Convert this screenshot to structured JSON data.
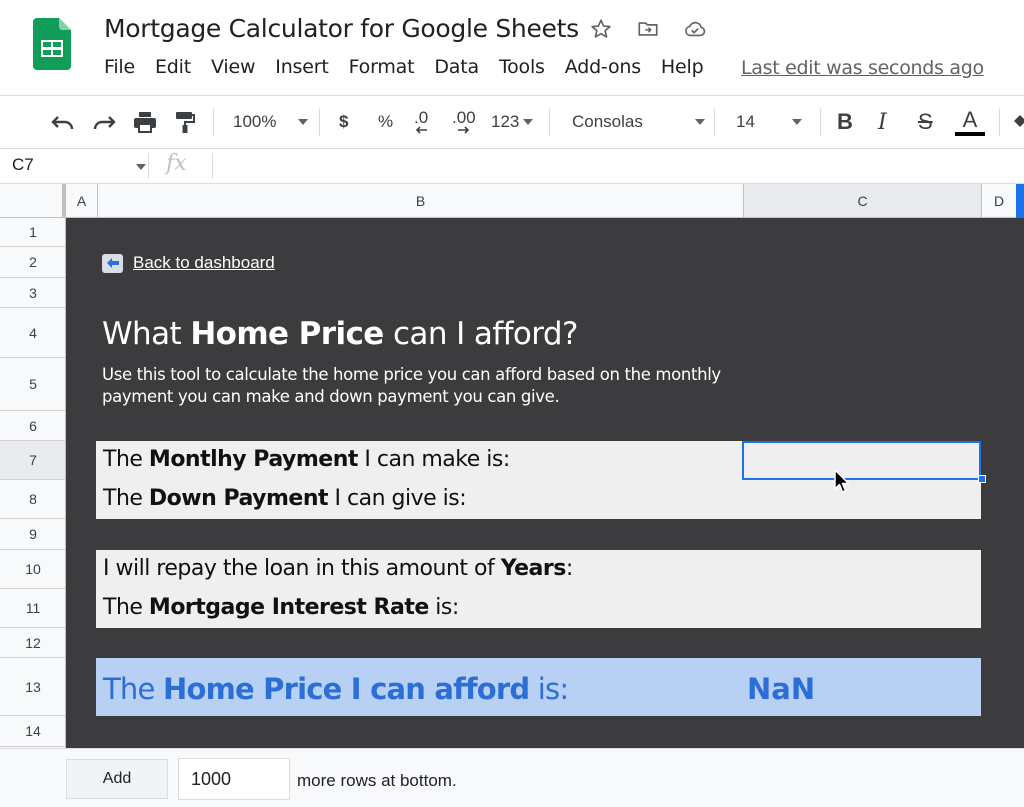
{
  "app": {
    "title": "Mortgage Calculator for Google Sheets",
    "last_edit": "Last edit was seconds ago",
    "colors": {
      "accent": "#1a73e8",
      "sheets_green": "#0f9d58",
      "dark_bg": "#3c3b3d",
      "result_bg": "#b8d0f3",
      "result_text": "#2b6fd6"
    }
  },
  "menu": [
    "File",
    "Edit",
    "View",
    "Insert",
    "Format",
    "Data",
    "Tools",
    "Add-ons",
    "Help"
  ],
  "toolbar": {
    "zoom": "100%",
    "currency": "$",
    "percent": "%",
    "decrease_decimal": ".0",
    "increase_decimal": ".00",
    "more_formats": "123",
    "font": "Consolas",
    "font_size": "14",
    "bold": "B",
    "italic": "I",
    "strike": "S",
    "text_color": "A"
  },
  "formula_bar": {
    "cell_ref": "C7",
    "fx": "fx",
    "value": ""
  },
  "columns": [
    "A",
    "B",
    "C",
    "D"
  ],
  "rows": [
    "1",
    "2",
    "3",
    "4",
    "5",
    "6",
    "7",
    "8",
    "9",
    "10",
    "11",
    "12",
    "13",
    "14"
  ],
  "content": {
    "back_link": "Back to dashboard",
    "heading": {
      "pre": "What ",
      "bold": "Home Price",
      "post": " can I afford?"
    },
    "description": "Use this tool to calculate the home price you can afford based on the monthly payment you can make and down payment you can give.",
    "panel1": [
      {
        "pre": "The ",
        "bold": "Montlhy Payment",
        "post": " I can make is:"
      },
      {
        "pre": "The ",
        "bold": "Down Payment",
        "post": " I can give is:"
      }
    ],
    "panel2": [
      {
        "pre": "I will repay the loan in this amount of ",
        "bold": "Years",
        "post": ":"
      },
      {
        "pre": "The ",
        "bold": "Mortgage Interest Rate",
        "post": " is:"
      }
    ],
    "result": {
      "pre": "The ",
      "bold": "Home Price I can afford",
      "post": " is:",
      "value": "NaN"
    }
  },
  "bottom": {
    "add_label": "Add",
    "rows_count": "1000",
    "more_rows": "more rows at bottom."
  }
}
